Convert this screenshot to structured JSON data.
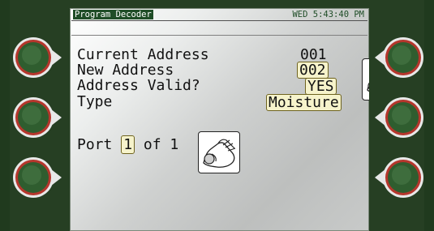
{
  "header": {
    "title": "Program Decoder",
    "datetime": "WED 5:43:40 PM"
  },
  "fields": [
    {
      "label": "Current Address",
      "value": "001",
      "editable": false
    },
    {
      "label": "New Address",
      "value": "002",
      "editable": true
    },
    {
      "label": "Address Valid?",
      "value": "YES",
      "editable": true
    },
    {
      "label": "Type",
      "value": "Moisture",
      "editable": true
    }
  ],
  "port": {
    "prefix": "Port",
    "value": "1",
    "suffix": "of 1"
  },
  "icons": {
    "hand": "hand-press-icon",
    "button": "side-button"
  },
  "colors": {
    "frame": "#253f22",
    "title_bg": "#1f4d27",
    "highlight_bg": "#f6f3cb",
    "button_ring": "#c43a2f",
    "button_core": "#2f5d2f"
  }
}
